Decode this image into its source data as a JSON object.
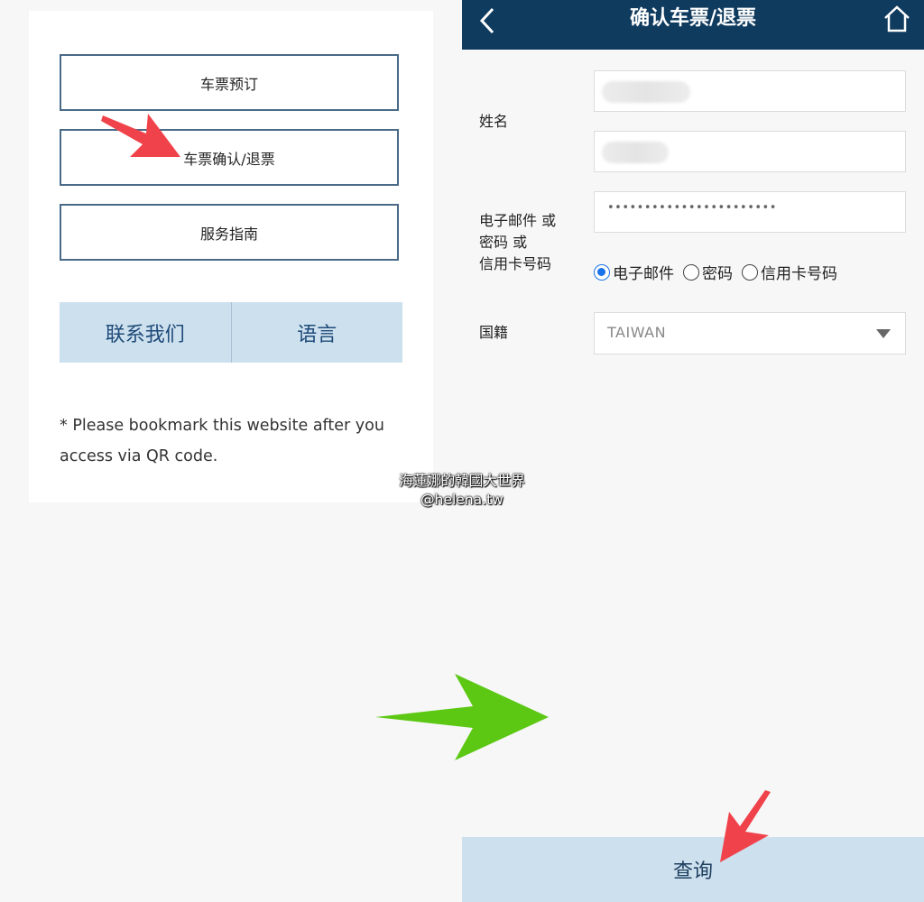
{
  "left": {
    "menu": [
      {
        "label": "车票预订"
      },
      {
        "label": "车票确认/退票"
      },
      {
        "label": "服务指南"
      }
    ],
    "contact_label": "联系我们",
    "language_label": "语言",
    "note": "* Please bookmark this website after you access via QR code."
  },
  "watermark": {
    "line1": "海蓮娜的韓國大世界",
    "line2": "@helena.tw"
  },
  "right": {
    "title": "确认车票/退票",
    "name_label": "姓名",
    "id_label_1": "电子邮件 或",
    "id_label_2": "密码 或",
    "id_label_3": "信用卡号码",
    "password_mask": "•••••••••••••••••••••••",
    "radios": [
      {
        "label": "电子邮件",
        "checked": true
      },
      {
        "label": "密码",
        "checked": false
      },
      {
        "label": "信用卡号码",
        "checked": false
      }
    ],
    "nationality_label": "国籍",
    "nationality_value": "TAIWAN",
    "query_label": "查询"
  },
  "colors": {
    "header": "#0f3b5f",
    "button_fill": "#cde0ee",
    "button_text": "#1e4a78",
    "red_arrow": "#f0424a",
    "green_arrow": "#5cc814"
  },
  "icons": [
    "back-icon",
    "home-icon",
    "caret-down-icon"
  ]
}
